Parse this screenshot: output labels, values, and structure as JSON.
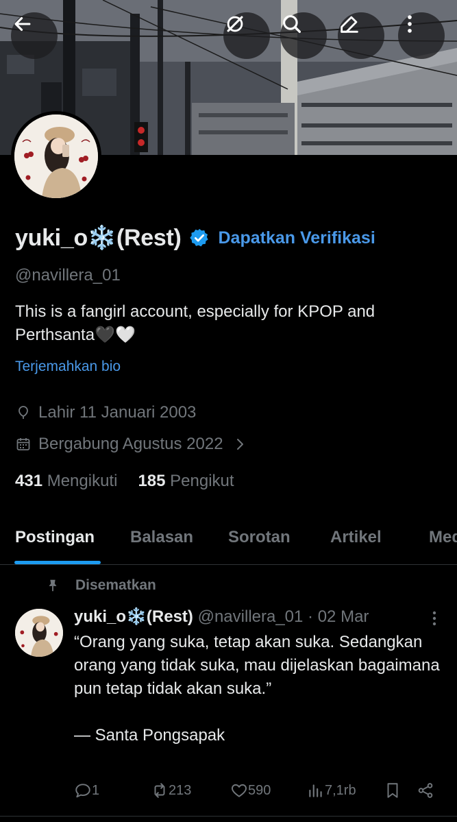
{
  "profile": {
    "display_name": "yuki_o❄️(Rest)",
    "get_verified_label": "Dapatkan Verifikasi",
    "handle": "@navillera_01",
    "bio": "This is a fangirl account, especially for KPOP and Perthsanta🖤🤍",
    "translate_label": "Terjemahkan bio",
    "birth": "Lahir 11 Januari 2003",
    "joined": "Bergabung Agustus 2022",
    "following_count": "431",
    "following_label": "Mengikuti",
    "followers_count": "185",
    "followers_label": "Pengikut"
  },
  "tabs": [
    {
      "label": "Postingan",
      "active": true
    },
    {
      "label": "Balasan",
      "active": false
    },
    {
      "label": "Sorotan",
      "active": false
    },
    {
      "label": "Artikel",
      "active": false
    },
    {
      "label": "Media",
      "active": false
    }
  ],
  "post": {
    "pinned_label": "Disematkan",
    "author_name": "yuki_o❄️(Rest)",
    "meta": "@navillera_01 · 02 Mar",
    "text": "“Orang yang suka, tetap akan suka. Sedangkan orang yang tidak suka, mau dijelaskan bagaimana pun tetap tidak akan suka.”\n\n— Santa Pongsapak",
    "replies": "1",
    "reposts": "213",
    "likes": "590",
    "views": "7,1rb"
  },
  "colors": {
    "accent": "#1d9bf0",
    "link": "#4a99e9",
    "muted": "#71767b",
    "text": "#e7e9ea",
    "background": "#000000"
  },
  "icons": {
    "back": "arrow-left-icon",
    "grok": "grok-icon",
    "search": "search-icon",
    "edit": "edit-icon",
    "more": "more-vertical-icon",
    "verified": "verified-badge-icon",
    "location": "birthday-balloon-icon",
    "calendar": "calendar-icon",
    "pin": "pin-icon"
  }
}
